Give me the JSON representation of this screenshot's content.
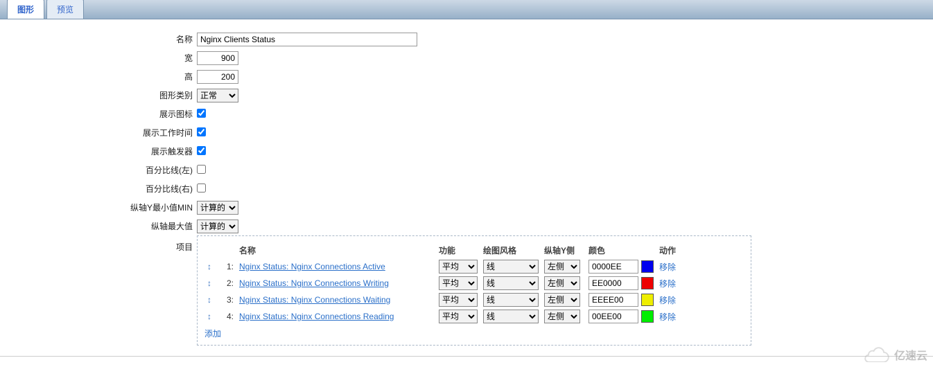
{
  "tabs": {
    "graph": "图形",
    "preview": "预览"
  },
  "labels": {
    "name": "名称",
    "width": "宽",
    "height": "高",
    "graph_type": "图形类别",
    "show_legend": "展示图标",
    "show_worktime": "展示工作时间",
    "show_triggers": "展示触发器",
    "percent_left": "百分比线(左)",
    "percent_right": "百分比线(右)",
    "ymin": "纵轴Y最小值MIN",
    "ymax": "纵轴最大值",
    "items": "项目"
  },
  "values": {
    "name": "Nginx Clients Status",
    "width": "900",
    "height": "200",
    "graph_type": "正常",
    "show_legend": true,
    "show_worktime": true,
    "show_triggers": true,
    "percent_left": false,
    "percent_right": false,
    "ymin": "计算的",
    "ymax": "计算的"
  },
  "items_header": {
    "name": "名称",
    "func": "功能",
    "style": "绘图风格",
    "yside": "纵轴Y侧",
    "color": "颜色",
    "action": "动作"
  },
  "defaults": {
    "func": "平均",
    "style": "线",
    "yside": "左侧",
    "remove": "移除"
  },
  "items": [
    {
      "idx": "1:",
      "name": "Nginx Status: Nginx Connections Active",
      "color": "0000EE",
      "swatch": "#0000EE"
    },
    {
      "idx": "2:",
      "name": "Nginx Status: Nginx Connections Writing",
      "color": "EE0000",
      "swatch": "#EE0000"
    },
    {
      "idx": "3:",
      "name": "Nginx Status: Nginx Connections Waiting",
      "color": "EEEE00",
      "swatch": "#EEEE00"
    },
    {
      "idx": "4:",
      "name": "Nginx Status: Nginx Connections Reading",
      "color": "00EE00",
      "swatch": "#00EE00"
    }
  ],
  "add_label": "添加",
  "watermark": "亿速云"
}
